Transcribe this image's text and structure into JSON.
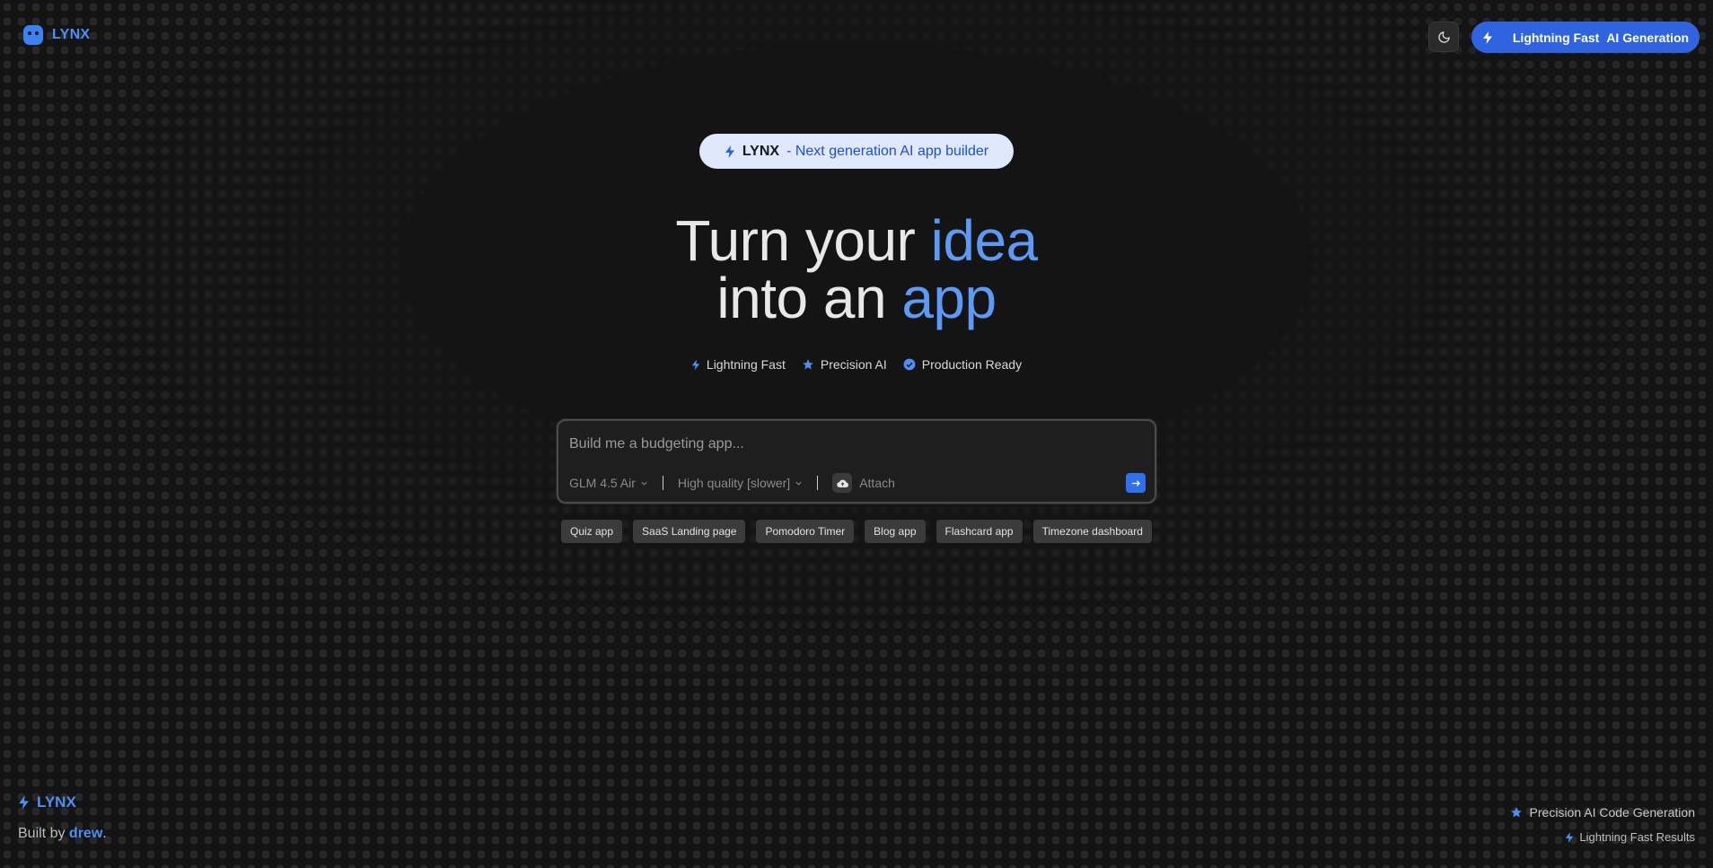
{
  "header": {
    "logo": "LYNX",
    "theme_toggle_icon": "moon-icon",
    "cta": {
      "part1": "Lightning Fast",
      "part2": "AI Generation"
    }
  },
  "hero": {
    "badge": {
      "brand": "LYNX",
      "text": "- Next generation AI app builder"
    },
    "headline": {
      "line1_a": "Turn your ",
      "line1_b": "idea",
      "line2_a": "into an ",
      "line2_b": "app"
    },
    "features": [
      {
        "label": "Lightning Fast",
        "icon": "bolt-icon"
      },
      {
        "label": "Precision AI",
        "icon": "star-icon"
      },
      {
        "label": "Production Ready",
        "icon": "check-badge-icon"
      }
    ]
  },
  "prompt": {
    "placeholder": "Build me a budgeting app...",
    "model": "GLM 4.5 Air",
    "quality": "High quality [slower]",
    "attach": "Attach",
    "send_icon": "arrow-right-icon"
  },
  "chips": [
    "Quiz app",
    "SaaS Landing page",
    "Pomodoro Timer",
    "Blog app",
    "Flashcard app",
    "Timezone dashboard"
  ],
  "footer": {
    "logo": "LYNX",
    "built_prefix": "Built by ",
    "author": "drew",
    "built_suffix": ".",
    "right1": "Precision AI Code Generation",
    "right2": "Lightning Fast Results"
  },
  "colors": {
    "accent": "#2f63e0",
    "highlight": "#5b9af6",
    "background": "#141414"
  }
}
